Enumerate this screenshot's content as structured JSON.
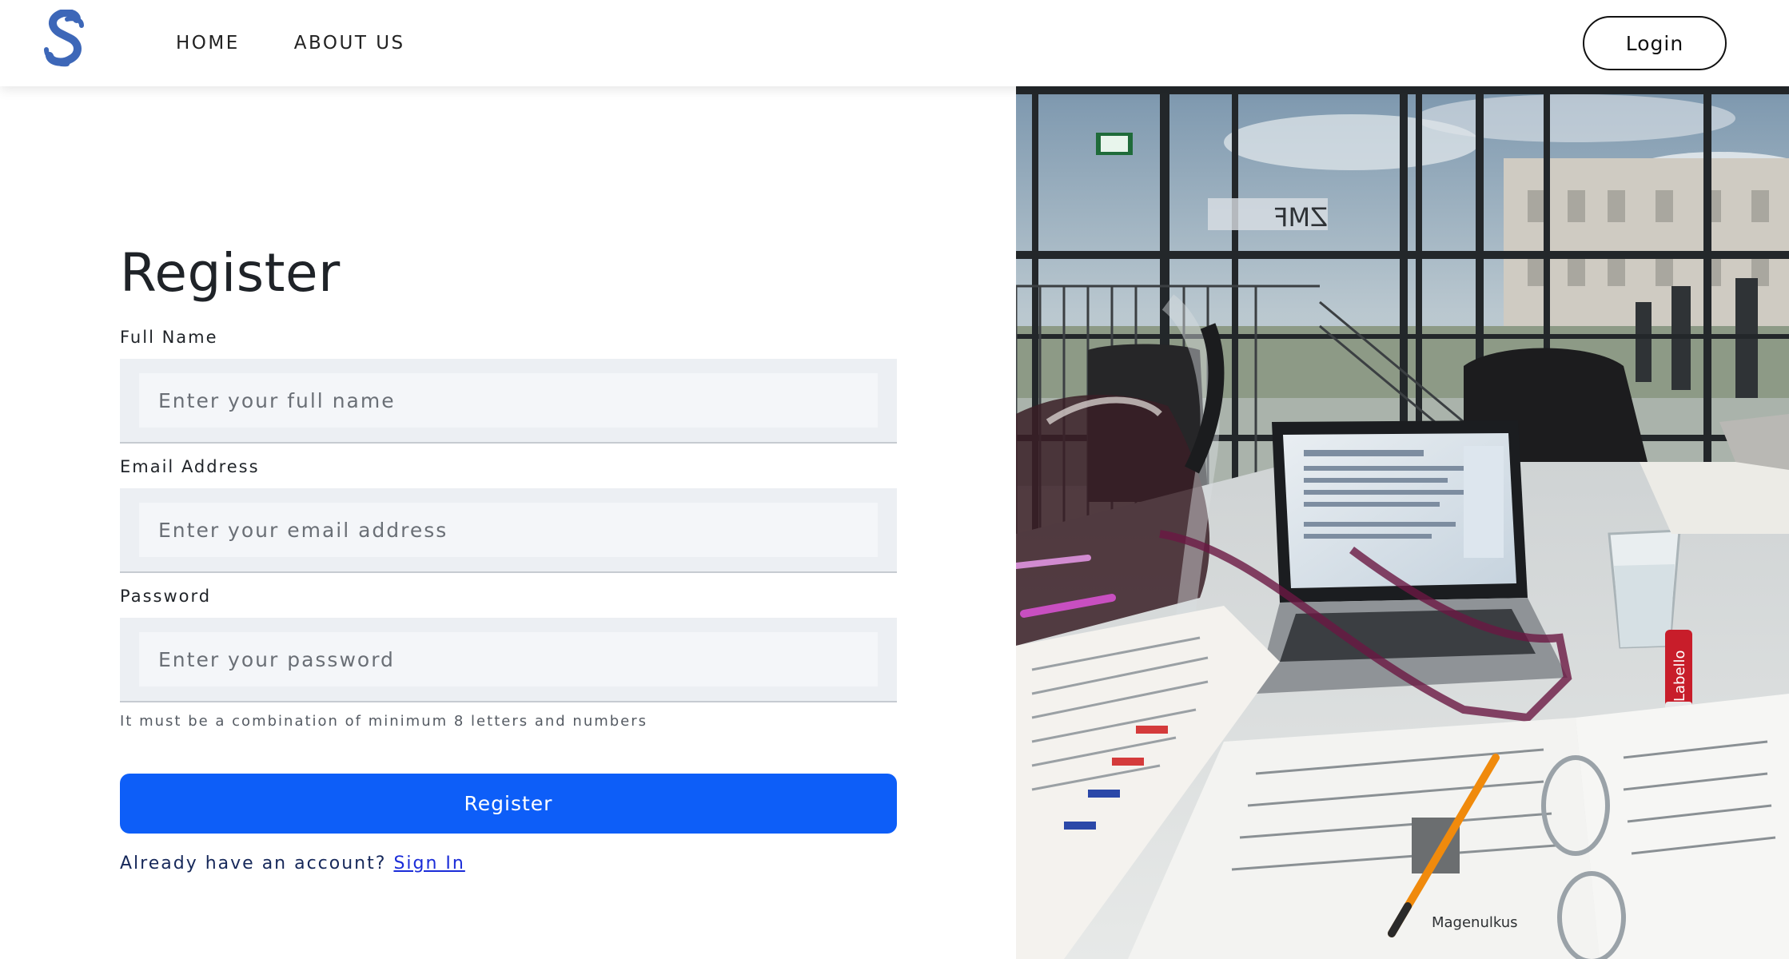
{
  "header": {
    "logo_alt": "S",
    "nav": [
      {
        "label": "HOME"
      },
      {
        "label": "ABOUT US"
      }
    ],
    "login_label": "Login"
  },
  "form": {
    "title": "Register",
    "full_name": {
      "label": "Full Name",
      "placeholder": "Enter your full name",
      "value": ""
    },
    "email": {
      "label": "Email Address",
      "placeholder": "Enter your email address",
      "value": ""
    },
    "password": {
      "label": "Password",
      "placeholder": "Enter your password",
      "value": ""
    },
    "password_hint": "It must be a combination of minimum 8 letters and numbers",
    "submit_label": "Register",
    "signin_prompt": "Already have an account?",
    "signin_link": "Sign In"
  },
  "photo": {
    "lip_balm_text": "Labello",
    "notes_caption": "Magenulkus"
  },
  "colors": {
    "primary": "#0d5ef8",
    "logo": "#3d67b8",
    "link": "#1a2cd8"
  }
}
